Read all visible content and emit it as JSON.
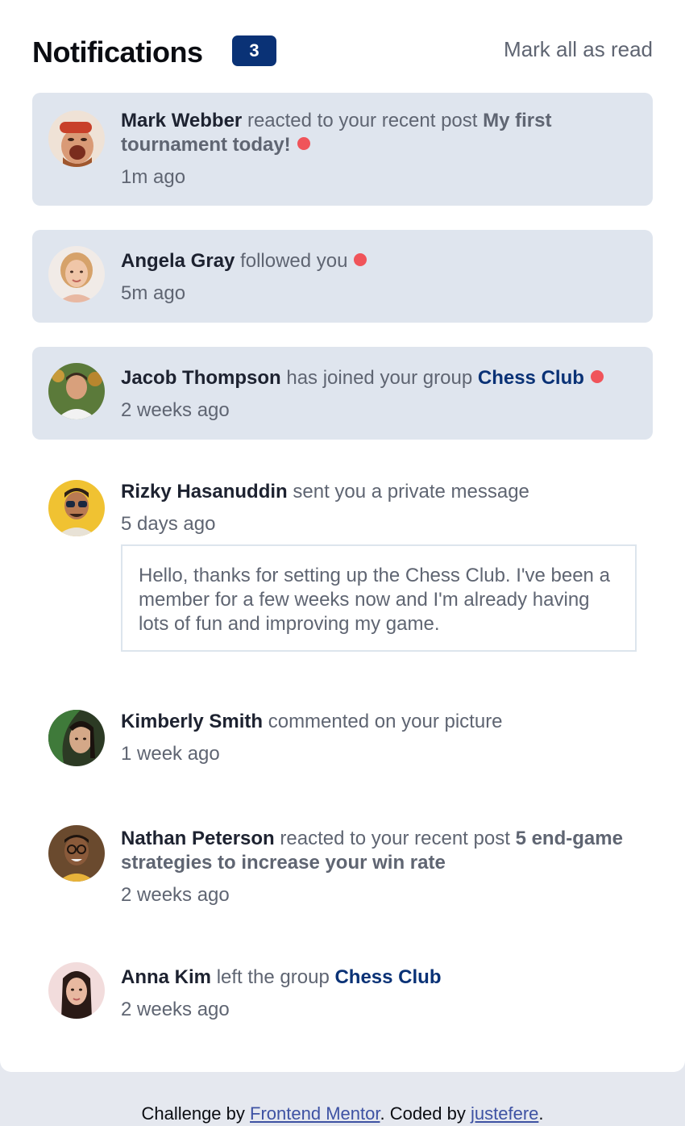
{
  "header": {
    "title": "Notifications",
    "unread_count": "3",
    "mark_all_label": "Mark all as read"
  },
  "notifications": [
    {
      "name": "Mark Webber",
      "action": "reacted to your recent post",
      "target": "My first tournament today!",
      "time": "1m ago",
      "unread": true
    },
    {
      "name": "Angela Gray",
      "action": "followed you",
      "time": "5m ago",
      "unread": true
    },
    {
      "name": "Jacob Thompson",
      "action": "has joined your group",
      "target": "Chess Club",
      "time": "2 weeks ago",
      "unread": true
    },
    {
      "name": "Rizky Hasanuddin",
      "action": "sent you a private message",
      "time": "5 days ago",
      "message": "Hello, thanks for setting up the Chess Club. I've been a member for a few weeks now and I'm already having lots of fun and improving my game.",
      "unread": false
    },
    {
      "name": "Kimberly Smith",
      "action": "commented on your picture",
      "time": "1 week ago",
      "unread": false
    },
    {
      "name": "Nathan Peterson",
      "action": "reacted to your recent post",
      "target": "5 end-game strategies to increase your win rate",
      "time": "2 weeks ago",
      "unread": false
    },
    {
      "name": "Anna Kim",
      "action": "left the group",
      "target": "Chess Club",
      "time": "2 weeks ago",
      "unread": false
    }
  ],
  "footer": {
    "prefix": "Challenge by",
    "link1": "Frontend Mentor",
    "middle": ". Coded by",
    "link2": "justefere",
    "suffix": "."
  },
  "colors": {
    "unread_bg": "#dfe5ee",
    "accent": "#0a3276",
    "dot": "#f0545a"
  }
}
